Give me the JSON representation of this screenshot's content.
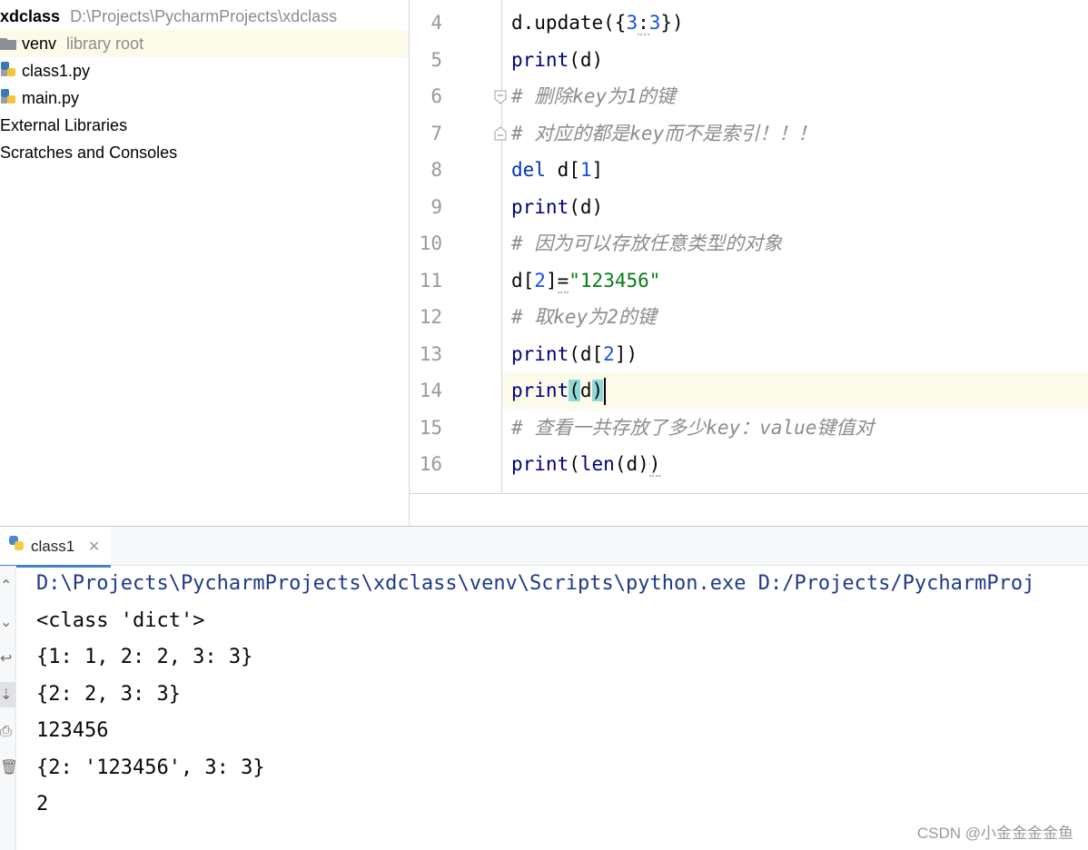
{
  "project_tree": {
    "project_name": "xdclass",
    "project_path": "D:\\Projects\\PycharmProjects\\xdclass",
    "items": [
      {
        "label": "venv",
        "note": "library root",
        "icon": "folder-icon"
      },
      {
        "label": "class1.py",
        "icon": "python-file-icon"
      },
      {
        "label": "main.py",
        "icon": "python-file-icon"
      },
      {
        "label": "External Libraries",
        "icon": "library-icon"
      },
      {
        "label": "Scratches and Consoles",
        "icon": "scratches-icon"
      }
    ]
  },
  "editor": {
    "current_line": "14",
    "lines": [
      {
        "n": "4",
        "a": "d.update({",
        "b": "3",
        "c": ":",
        "d": "3",
        "e": "})"
      },
      {
        "n": "5",
        "a": "print",
        "b": "(d)"
      },
      {
        "n": "6",
        "text": "# 删除key为1的键"
      },
      {
        "n": "7",
        "text": "# 对应的都是key而不是索引！！！"
      },
      {
        "n": "8",
        "a": "del",
        "b": " d[",
        "c": "1",
        "d": "]"
      },
      {
        "n": "9",
        "a": "print",
        "b": "(d)"
      },
      {
        "n": "10",
        "text": "# 因为可以存放任意类型的对象"
      },
      {
        "n": "11",
        "a": "d[",
        "b": "2",
        "c": "]",
        "d": "=",
        "e": "\"123456\""
      },
      {
        "n": "12",
        "text": "# 取key为2的键"
      },
      {
        "n": "13",
        "a": "print",
        "b": "(d[",
        "c": "2",
        "d": "])"
      },
      {
        "n": "14",
        "a": "print",
        "b": "(",
        "c": "d",
        "d": ")"
      },
      {
        "n": "15",
        "text": "# 查看一共存放了多少key：value键值对"
      },
      {
        "n": "16",
        "a": "print",
        "b": "(",
        "c": "len",
        "d": "(d)",
        "e": ")"
      }
    ]
  },
  "run": {
    "tab_label": "class1",
    "output": [
      "D:\\Projects\\PycharmProjects\\xdclass\\venv\\Scripts\\python.exe D:/Projects/PycharmProj",
      "<class 'dict'>",
      "{1: 1, 2: 2, 3: 3}",
      "{2: 2, 3: 3}",
      "123456",
      "{2: '123456', 3: 3}",
      "2"
    ]
  },
  "watermark": "CSDN @小金金金金鱼",
  "colors": {
    "keyword": "#0033b3",
    "number": "#1750eb",
    "string": "#067d17",
    "comment": "#8c8c8c",
    "current_line": "#fcfae9"
  }
}
